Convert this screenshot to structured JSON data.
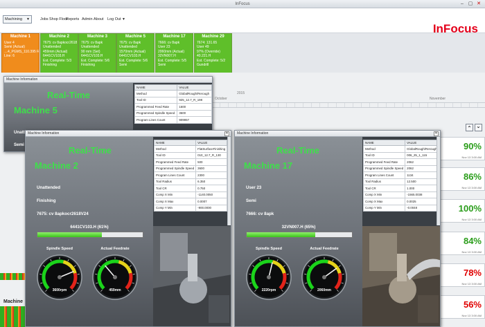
{
  "window": {
    "title": "InFocus"
  },
  "menu": {
    "select": "Machining",
    "items": [
      "Jobs",
      "Shop Floor",
      "Reports",
      "Admin",
      "About",
      "Log Out"
    ],
    "logo": "InFocus"
  },
  "tiles": [
    {
      "name": "Machine 1",
      "color": "orange",
      "lines": [
        "User 4",
        "Semi (Actual)",
        "…4_PGMS_110.395 R",
        "Line: 6"
      ]
    },
    {
      "name": "Machine 2",
      "color": "green",
      "lines": [
        "7675: cv 8apkocr2618",
        "Unattended",
        "459mm (Actual)",
        "6441CV103.H",
        "Est. Complete: 5/3",
        "Finishing"
      ]
    },
    {
      "name": "Machine 3",
      "color": "green",
      "lines": [
        "7675: cv 8apk",
        "Unattended",
        "90 mm (Set)",
        "6441CV103.H",
        "Est. Complete: 5/6",
        "Finishing"
      ]
    },
    {
      "name": "Machine 5",
      "color": "green",
      "lines": [
        "7675: cv 8apk",
        "Unattended",
        "1570mm (Actual)",
        "6441CV103.H",
        "Est. Complete: 5/6",
        "Semi"
      ]
    },
    {
      "name": "Machine 17",
      "color": "green",
      "lines": [
        "7666: cv 8apk",
        "User 23",
        "2060mm (Actual)",
        "32VN007.H",
        "Est. Complete: 5/5",
        "Semi"
      ]
    },
    {
      "name": "Machine 29",
      "color": "green",
      "lines": [
        "7674: 131.65",
        "User 49",
        "97% (Override)",
        "40.221.H",
        "Est. Complete: 5/2",
        "Gundrill"
      ]
    }
  ],
  "timeline": {
    "year": "2015",
    "months": [
      "October",
      "November"
    ],
    "percents": [
      "90%",
      "86%",
      "100%",
      "84%",
      "78%",
      "56%"
    ],
    "percent_colors": [
      "#2a9d1a",
      "#2a9d1a",
      "#2a9d1a",
      "#2a9d1a",
      "#e00000",
      "#e00000"
    ],
    "date_left": "AM",
    "date_right": "Nov 13 3:00 AM",
    "nav_up": "⌃",
    "nav_down": "⌄"
  },
  "win5": {
    "title": "Machine Information",
    "realtime": "Real-Time",
    "machine": "Machine 5",
    "partial_lines": [
      "Unatt",
      "Semi",
      "7675"
    ],
    "table_headers": [
      "NAME",
      "VALUE"
    ],
    "rows": [
      [
        "Method",
        "GlobalRough/Rerough"
      ],
      [
        "Tool ID",
        "925_12.7_R_198"
      ],
      [
        "Programmed Feed Rate",
        "1600"
      ],
      [
        "Programmed Spindle Speed",
        "3600"
      ],
      [
        "Program Lines Count",
        "909957"
      ]
    ],
    "footer_label": "Machine"
  },
  "win2": {
    "title": "Machine Information",
    "realtime": "Real-Time",
    "machine": "Machine 2",
    "status": "Unattended",
    "operation": "Finishing",
    "program": "7675: cv 8apkocr2618V24",
    "progress_label": "6441CV103.H (61%)",
    "progress": 0.61,
    "gauge1_label": "Spindle Speed",
    "gauge1_value": "3600rpm",
    "gauge1_level": 0.75,
    "gauge2_label": "Actual Feedrate",
    "gauge2_value": "459mm",
    "gauge2_level": 0.35,
    "table_headers": [
      "NAME",
      "VALUE"
    ],
    "rows": [
      [
        "Method",
        "FlatSurfaceFinishing"
      ],
      [
        "Tool ID",
        "010_12.7_R_130"
      ],
      [
        "Programmed Feed Rate",
        "500"
      ],
      [
        "Programmed Spindle Speed",
        "3600"
      ],
      [
        "Program Lines Count",
        "2300"
      ],
      [
        "Tool Radius",
        "6.350"
      ],
      [
        "Tool CR",
        "0.750"
      ],
      [
        "Comp X Min",
        "-1140.0050"
      ],
      [
        "Comp X Max",
        "0.0007"
      ],
      [
        "Comp Y Min",
        "-900.0000"
      ]
    ]
  },
  "win17": {
    "title": "Machine Information",
    "realtime": "Real-Time",
    "machine": "Machine 17",
    "status": "User 23",
    "operation": "Semi",
    "program": "7666: cv 8apk",
    "progress_label": "32VN007.H (65%)",
    "progress": 0.65,
    "gauge1_label": "Spindle Speed",
    "gauge1_value": "2220rpm",
    "gauge1_level": 0.55,
    "gauge2_label": "Actual Feedrate",
    "gauge2_value": "2060mm",
    "gauge2_level": 0.7,
    "table_headers": [
      "NAME",
      "VALUE"
    ],
    "rows": [
      [
        "Method",
        "GlobalRough/Rerough"
      ],
      [
        "Tool ID",
        "006_25_1_115"
      ],
      [
        "Programmed Feed Rate",
        "2062"
      ],
      [
        "Programmed Spindle Speed",
        "2062"
      ],
      [
        "Program Lines Count",
        "1134"
      ],
      [
        "Tool Radius",
        "12.500"
      ],
      [
        "Tool CR",
        "1.000"
      ],
      [
        "Comp X Min",
        "-1565.0038"
      ],
      [
        "Comp X Max",
        "0.0025"
      ],
      [
        "Comp Y Min",
        "-0.0048"
      ]
    ]
  }
}
